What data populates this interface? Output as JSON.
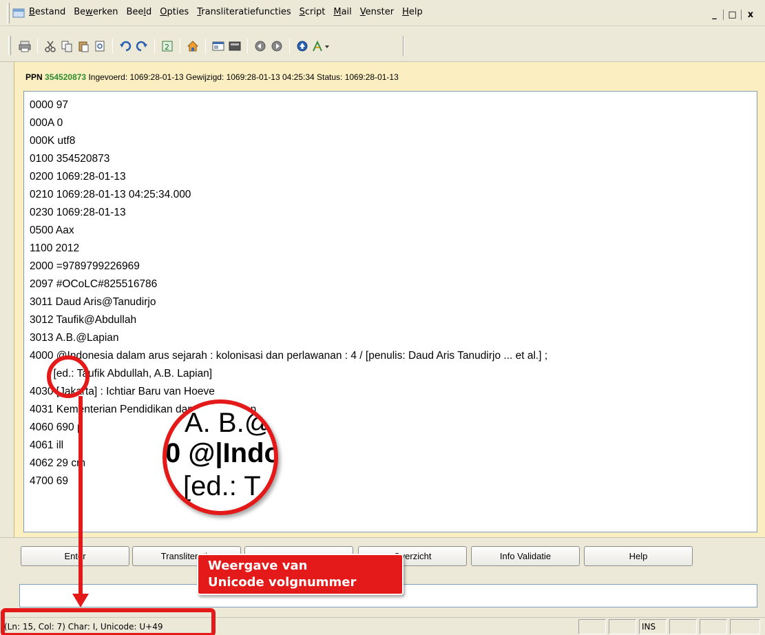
{
  "menubar": {
    "items": [
      "Bestand",
      "Bewerken",
      "Beeld",
      "Opties",
      "Transliteratiefuncties",
      "Script",
      "Mail",
      "Venster",
      "Help"
    ],
    "controls": [
      "_",
      "□",
      "x"
    ]
  },
  "toolbar": {
    "icons": [
      "print-icon",
      "cut-icon",
      "copy-icon",
      "paste-icon",
      "preview-icon",
      "undo-icon",
      "redo-icon",
      "refresh-icon",
      "home-icon",
      "window-icon",
      "panel-icon",
      "back-icon",
      "forward-icon",
      "up-icon",
      "script-icon"
    ]
  },
  "record": {
    "ppn_label": "PPN",
    "ppn_number": "354520873",
    "meta": "Ingevoerd: 1069:28-01-13 Gewijzigd: 1069:28-01-13 04:25:34 Status: 1069:28-01-13"
  },
  "editor": {
    "lines": [
      "0000 97",
      "000A 0",
      "000K utf8",
      "0100 354520873",
      "0200 1069:28-01-13",
      "0210 1069:28-01-13 04:25:34.000",
      "0230 1069:28-01-13",
      "0500 Aax",
      "1100 2012",
      "2000 =9789799226969",
      "2097 #OCoLC#825516786",
      "3011 Daud Aris@Tanudirjo",
      "3012 Taufik@Abdullah",
      "3013 A.B.@Lapian",
      "4000 @Indonesia dalam arus sejarah : kolonisasi dan perlawanan : 4 / [penulis: Daud Aris Tanudirjo ... et al.] ;",
      "        [ed.: Taufik Abdullah, A.B. Lapian]",
      "4030 [Jakarta] : Ichtiar Baru van Hoeve",
      "4031 Kementerian Pendidikan dan Kebudayaan",
      "4060 690 p",
      "4061 ill",
      "4062 29 cm",
      "4700 69"
    ]
  },
  "buttons": {
    "enter": "Enter",
    "transliteratie": "Transliteratie",
    "button3": "",
    "overzicht": "Overzicht",
    "info_validatie": "Info Validatie",
    "help": "Help"
  },
  "status": {
    "text": "(Ln: 15, Col:  7)  Char: I,  Unicode:  U+49",
    "ins": "INS"
  },
  "annotation": {
    "callout_line1": "Weergave van",
    "callout_line2": "Unicode volgnummer",
    "mag_line1": "A. B.@",
    "mag_line2": "0 @|Indo",
    "mag_line3": "[ed.: T",
    "color": "#e41a1a"
  }
}
